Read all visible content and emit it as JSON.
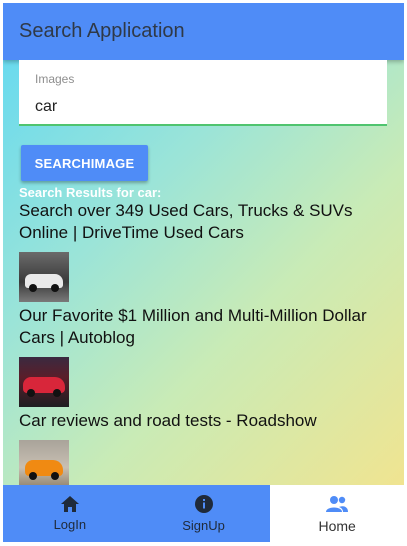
{
  "appbar": {
    "title": "Search Application"
  },
  "search": {
    "label": "Images",
    "value": "car"
  },
  "button": {
    "label": "SEARCHIMAGE"
  },
  "results": {
    "heading": "Search Results for car:",
    "items": [
      {
        "title": "Search over 349 Used Cars, Trucks & SUVs Online | DriveTime Used Cars"
      },
      {
        "title": "Our Favorite $1 Million and Multi-Million Dollar Cars | Autoblog"
      },
      {
        "title": "Car reviews and road tests - Roadshow"
      }
    ]
  },
  "nav": {
    "items": [
      {
        "label": "LogIn",
        "icon": "home-icon"
      },
      {
        "label": "SignUp",
        "icon": "info-icon"
      },
      {
        "label": "Home",
        "icon": "people-icon",
        "active": true
      }
    ]
  },
  "colors": {
    "primary": "#4f8cf7",
    "underline": "#4fc46f"
  }
}
